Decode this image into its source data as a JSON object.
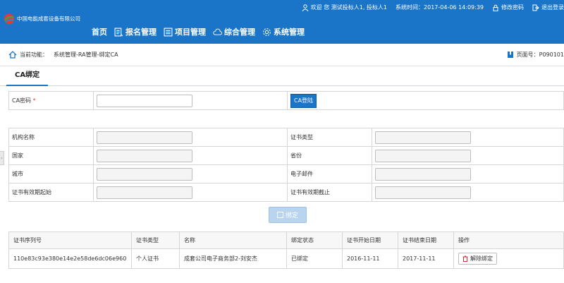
{
  "header": {
    "company": "中国电能成套设备有限公司",
    "welcome": "欢迎 您 测试投标人1, 投标人1",
    "system_time_label": "系统时间：",
    "system_time": "2017-04-06 14:09:39",
    "change_password": "修改密码",
    "logout": "退出登录",
    "nav": [
      {
        "label": "首页",
        "icon": "home"
      },
      {
        "label": "报名管理",
        "icon": "list-icon"
      },
      {
        "label": "项目管理",
        "icon": "list-icon"
      },
      {
        "label": "综合管理",
        "icon": "cloud-icon"
      },
      {
        "label": "系统管理",
        "icon": "gear-icon"
      }
    ],
    "accent": "#1a74c8"
  },
  "breadcrumb": {
    "label": "当前功能：",
    "path": "系统管理-RA管理-绑定CA",
    "page_label": "页面号：",
    "page_no": "P090101"
  },
  "tab": {
    "label": "CA绑定"
  },
  "ca_form": {
    "password_label": "CA密码",
    "required_mark": "*",
    "password_value": "",
    "login_button": "CA登陆"
  },
  "cert_form": {
    "org_name_label": "机构名称",
    "org_name_value": "",
    "cert_type_label": "证书类型",
    "cert_type_value": "",
    "country_label": "国家",
    "country_value": "",
    "province_label": "省份",
    "province_value": "",
    "city_label": "城市",
    "city_value": "",
    "email_label": "电子邮件",
    "email_value": "",
    "valid_start_label": "证书有效期起始",
    "valid_start_value": "",
    "valid_end_label": "证书有效期截止",
    "valid_end_value": ""
  },
  "bind_button": "绑定",
  "result_table": {
    "headers": [
      "证书序列号",
      "证书类型",
      "名称",
      "绑定状态",
      "证书开始日期",
      "证书结束日期",
      "操作"
    ],
    "rows": [
      {
        "serial": "110e83c93e380e14e2e58de6dc06e960",
        "type": "个人证书",
        "name": "成套公司电子商务部2-刘安杰",
        "status": "已绑定",
        "start": "2016-11-11",
        "end": "2017-11-11",
        "action": "解除绑定"
      }
    ]
  }
}
